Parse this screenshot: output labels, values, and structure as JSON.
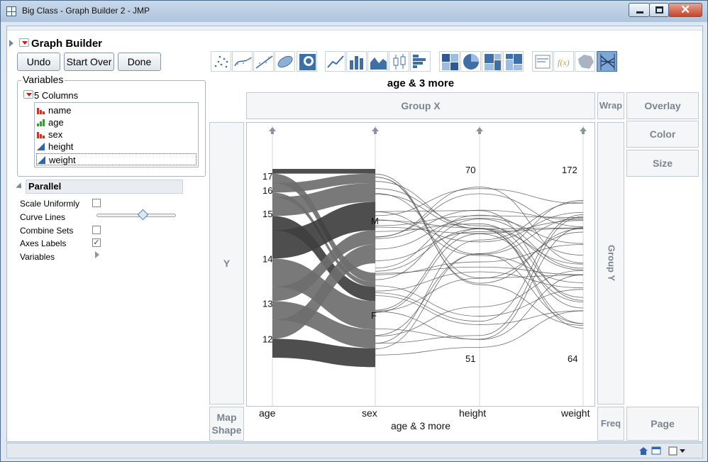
{
  "window": {
    "title": "Big Class - Graph Builder 2 - JMP"
  },
  "graph_builder": {
    "title": "Graph Builder"
  },
  "buttons": {
    "undo": "Undo",
    "start_over": "Start Over",
    "done": "Done"
  },
  "variables": {
    "label": "Variables",
    "columns_label": "5 Columns",
    "columns": [
      {
        "name": "name",
        "type": "nominal"
      },
      {
        "name": "age",
        "type": "ordinal"
      },
      {
        "name": "sex",
        "type": "nominal"
      },
      {
        "name": "height",
        "type": "continuous"
      },
      {
        "name": "weight",
        "type": "continuous",
        "selected": true
      }
    ]
  },
  "parallel": {
    "title": "Parallel",
    "options": [
      {
        "label": "Scale Uniformly",
        "control": "checkbox",
        "checked": false
      },
      {
        "label": "Curve Lines",
        "control": "slider",
        "value": 0.55
      },
      {
        "label": "Combine Sets",
        "control": "checkbox",
        "checked": false
      },
      {
        "label": "Axes Labels",
        "control": "checkbox",
        "checked": true
      },
      {
        "label": "Variables",
        "control": "expander"
      }
    ]
  },
  "toolbar": {
    "icons": [
      "points-icon",
      "smoother-icon",
      "line-of-fit-icon",
      "ellipse-icon",
      "contour-icon",
      "line-icon",
      "bar-icon",
      "area-icon",
      "box-plot-icon",
      "histogram-icon",
      "heatmap-icon",
      "pie-icon",
      "treemap-icon",
      "mosaic-icon",
      "caption-box-icon",
      "formula-icon",
      "map-shapes-icon",
      "parallel-icon"
    ],
    "active": "parallel-icon"
  },
  "zones": {
    "group_x": "Group X",
    "group_y": "Group Y",
    "wrap": "Wrap",
    "overlay": "Overlay",
    "color": "Color",
    "size": "Size",
    "y": "Y",
    "map_shape": "Map Shape",
    "freq": "Freq",
    "page": "Page"
  },
  "colors": {
    "band": "#6e6e6e",
    "band_dark": "#3f3f3f",
    "line": "#555555",
    "accent": "#3e6fa6"
  },
  "chart_data": {
    "type": "parallel",
    "title": "age & 3 more",
    "xlabel": "age & 3 more",
    "axes": [
      "age",
      "sex",
      "height",
      "weight"
    ],
    "age": {
      "categories": [
        "17",
        "16",
        "15",
        "14",
        "13",
        "12"
      ],
      "counts": [
        3,
        3,
        7,
        12,
        7,
        8
      ]
    },
    "sex": {
      "categories": [
        "M",
        "F"
      ],
      "counts": [
        22,
        18
      ]
    },
    "height": {
      "range": [
        51,
        70
      ]
    },
    "weight": {
      "range": [
        64,
        172
      ]
    }
  }
}
